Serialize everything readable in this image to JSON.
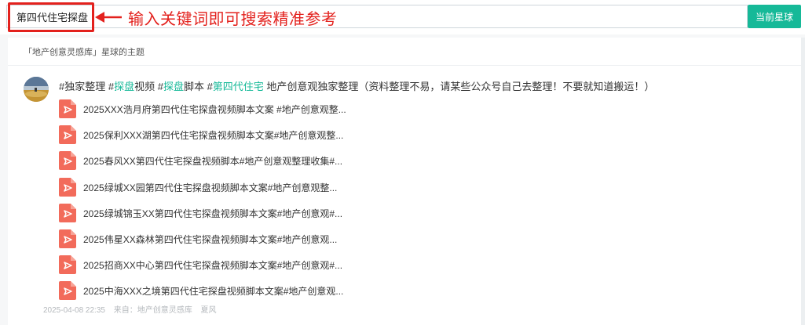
{
  "search": {
    "value": "第四代住宅探盘",
    "button_label": "当前星球"
  },
  "annotation": {
    "text": "输入关键词即可搜索精准参考",
    "color": "#e3211d"
  },
  "panel": {
    "header": "「地产创意灵感库」星球的主题"
  },
  "post": {
    "text": {
      "part1": "#独家整理 #",
      "hl1": "探盘",
      "part2": "视频 #",
      "hl2": "探盘",
      "part3": "脚本 #",
      "hl3": "第四代住宅",
      "part4": " 地产创意观独家整理（资料整理不易，请某些公众号自己去整理！不要就知道搬运！）"
    },
    "files": [
      "2025XXX浩月府第四代住宅探盘视频脚本文案 #地产创意观整...",
      "2025保利XXX湖第四代住宅探盘视频脚本文案#地产创意观整...",
      "2025春风XX第四代住宅探盘视频脚本#地产创意观整理收集#...",
      "2025绿城XX园第四代住宅探盘视频脚本文案#地产创意观整...",
      "2025绿城锦玉XX第四代住宅探盘视频脚本文案#地产创意观#...",
      "2025伟星XX森林第四代住宅探盘视频脚本文案#地产创意观...",
      "2025招商XX中心第四代住宅探盘视频脚本文案#地产创意观#...",
      "2025中海XXX之境第四代住宅探盘视频脚本文案#地产创意观..."
    ],
    "meta": {
      "date": "2025-04-08 22:35",
      "source": "来自：地产创意灵感库",
      "author": "夏风"
    }
  },
  "colors": {
    "accent": "#16b998",
    "file_icon": "#f26b5b"
  },
  "icons": {
    "file": "pdf-file-icon",
    "arrow": "left-arrow-icon"
  }
}
